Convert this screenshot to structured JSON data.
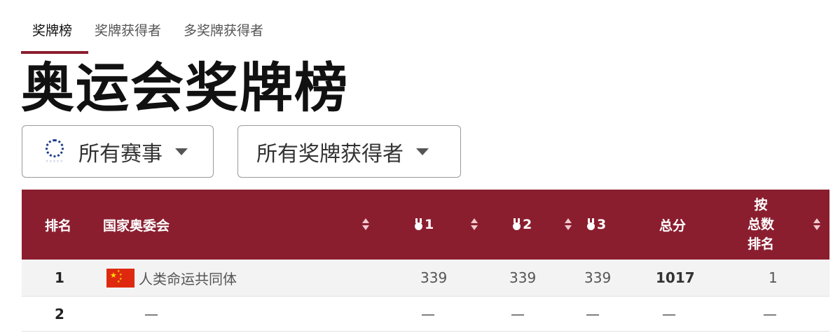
{
  "tabs": [
    {
      "label": "奖牌榜",
      "active": true
    },
    {
      "label": "奖牌获得者",
      "active": false
    },
    {
      "label": "多奖牌获得者",
      "active": false
    }
  ],
  "page_title": "奥运会奖牌榜",
  "filters": {
    "events": {
      "label": "所有赛事",
      "icon": "games-emblem-icon"
    },
    "medalists": {
      "label": "所有奖牌获得者"
    }
  },
  "colors": {
    "accent": "#8a1e2f",
    "header_text": "#ffffff",
    "row_alt": "#f3f3f3"
  },
  "table": {
    "headers": {
      "rank": "排名",
      "noc": "国家奥委会",
      "gold": "1",
      "silver": "2",
      "bronze": "3",
      "total": "总分",
      "rank_by_total_1": "按",
      "rank_by_total_2": "总数",
      "rank_by_total_3": "排名"
    },
    "rows": [
      {
        "rank": "1",
        "flag": "china-flag-icon",
        "name": "人类命运共同体",
        "gold": "339",
        "silver": "339",
        "bronze": "339",
        "total": "1017",
        "rank_by_total": "1"
      },
      {
        "rank": "2",
        "name": "—",
        "gold": "—",
        "silver": "—",
        "bronze": "—",
        "total": "—",
        "rank_by_total": "—"
      }
    ]
  }
}
